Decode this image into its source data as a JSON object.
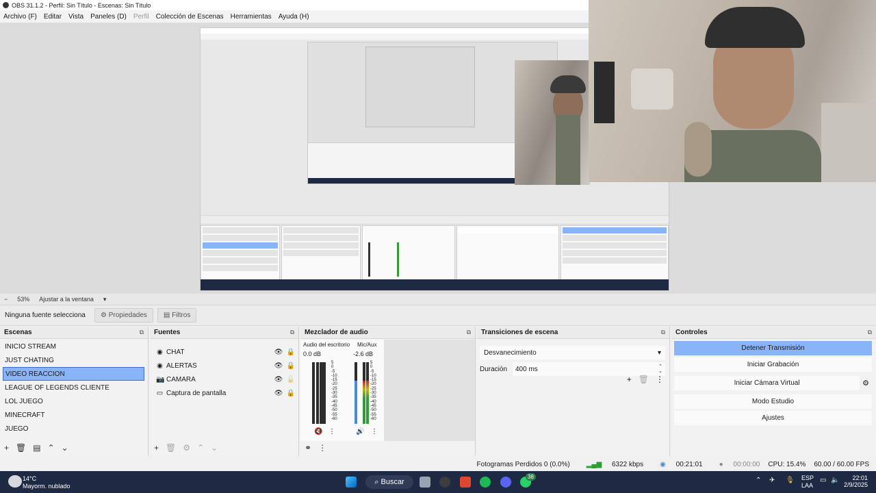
{
  "window": {
    "title": "OBS 31.1.2 - Perfil: Sin Título - Escenas: Sin Título"
  },
  "menu": [
    "Archivo (F)",
    "Editar",
    "Vista",
    "Paneles (D)",
    "Perfil",
    "Colección de Escenas",
    "Herramientas",
    "Ayuda (H)"
  ],
  "zoom": {
    "value": "53%",
    "fit": "Ajustar a la ventana"
  },
  "source_bar": {
    "none": "Ninguna fuente selecciona",
    "properties": "Propiedades",
    "filters": "Filtros"
  },
  "scenes": {
    "title": "Escenas",
    "items": [
      "INICIO STREAM",
      "JUST CHATING",
      "VIDEO REACCION",
      "LEAGUE OF LEGENDS CLIENTE",
      "LOL JUEGO",
      "MINECRAFT",
      "JUEGO"
    ],
    "selected": 2
  },
  "sources": {
    "title": "Fuentes",
    "items": [
      {
        "name": "CHAT",
        "icon": "browser-icon"
      },
      {
        "name": "ALERTAS",
        "icon": "browser-icon"
      },
      {
        "name": "CAMARA",
        "icon": "camera-icon"
      },
      {
        "name": "Captura de pantalla",
        "icon": "monitor-icon"
      }
    ]
  },
  "mixer": {
    "title": "Mezclador de audio",
    "channels": [
      {
        "name": "Audio del escritorio",
        "db": "0.0 dB",
        "level": 0.0,
        "muted": true
      },
      {
        "name": "Mic/Aux",
        "db": "-2.6 dB",
        "level": 0.7,
        "muted": false
      }
    ],
    "scale": [
      "5",
      "0",
      "-5",
      "-10",
      "-15",
      "-20",
      "-25",
      "-30",
      "-35",
      "-40",
      "-45",
      "-50",
      "-55",
      "-60"
    ]
  },
  "transitions": {
    "title": "Transiciones de escena",
    "selected": "Desvanecimiento",
    "duration_label": "Duración",
    "duration_value": "400 ms"
  },
  "controls": {
    "title": "Controles",
    "buttons": [
      "Detener Transmisión",
      "Iniciar Grabación",
      "Iniciar Cámara Virtual",
      "Modo Estudio",
      "Ajustes"
    ]
  },
  "status": {
    "dropped": "Fotogramas Perdidos 0 (0.0%)",
    "bitrate": "6322 kbps",
    "stream_time": "00:21:01",
    "rec_time": "00:00:00",
    "cpu": "CPU: 15.4%",
    "fps": "60.00 / 60.00 FPS"
  },
  "taskbar": {
    "temp": "14°C",
    "weather": "Mayorm. nublado",
    "search": "Buscar",
    "lang": "ESP",
    "region": "LAA",
    "time": "22:01",
    "date": "2/9/2025",
    "badge": "38"
  },
  "colors": {
    "accent": "#8ab4f8",
    "taskbar": "#1e2a44"
  }
}
